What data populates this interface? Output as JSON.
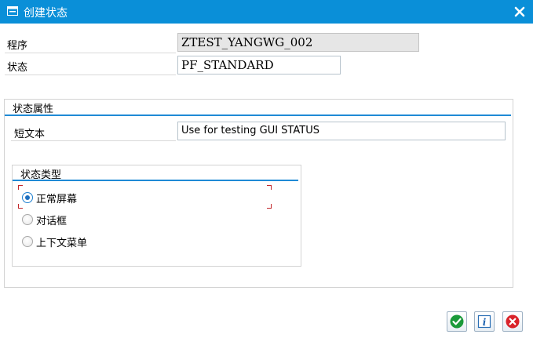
{
  "window": {
    "title": "创建状态",
    "title_bar_color": "#0a8fd8"
  },
  "form": {
    "program_label": "程序",
    "program_value": "ZTEST_YANGWG_002",
    "status_label": "状态",
    "status_value": "PF_STANDARD"
  },
  "attributes": {
    "title": "状态属性",
    "short_text_label": "短文本",
    "short_text_value": "Use for testing GUI STATUS"
  },
  "status_type": {
    "title": "状态类型",
    "options": [
      {
        "label": "正常屏幕",
        "selected": true
      },
      {
        "label": "对话框",
        "selected": false
      },
      {
        "label": "上下文菜单",
        "selected": false
      }
    ]
  },
  "buttons": {
    "confirm_icon": "checkmark-icon",
    "info_icon": "info-icon",
    "cancel_icon": "cancel-icon"
  },
  "colors": {
    "accent": "#1f8ad6",
    "confirm": "#1b9a3a",
    "cancel": "#d9232a",
    "focus": "#c2282c"
  }
}
